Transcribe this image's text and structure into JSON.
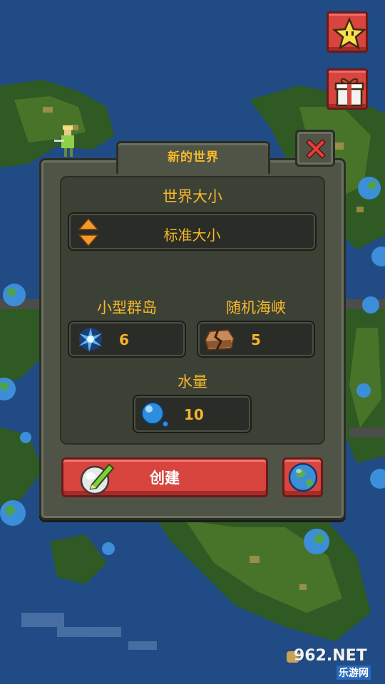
{
  "dialog": {
    "title": "新的世界",
    "world_size": {
      "label": "世界大小",
      "value": "标准大小"
    },
    "islands": {
      "label": "小型群岛",
      "value": "6"
    },
    "straits": {
      "label": "随机海峡",
      "value": "5"
    },
    "water": {
      "label": "水量",
      "value": "10"
    },
    "create_label": "创建"
  },
  "watermark": {
    "brand": "962.NET",
    "site": "乐游网"
  },
  "icons": {
    "star": "star-icon",
    "gift": "gift-icon",
    "close": "close-x-icon",
    "arrows": "up-down-arrows-icon",
    "islands": "blue-spark-icon",
    "straits": "rock-crack-icon",
    "water": "water-bubble-icon",
    "create": "pencil-orb-icon",
    "random_world": "globe-icon"
  },
  "colors": {
    "accent_text": "#f7b92b",
    "button_red": "#d8443e",
    "panel": "#4f5446",
    "ocean": "#1d4a82"
  }
}
